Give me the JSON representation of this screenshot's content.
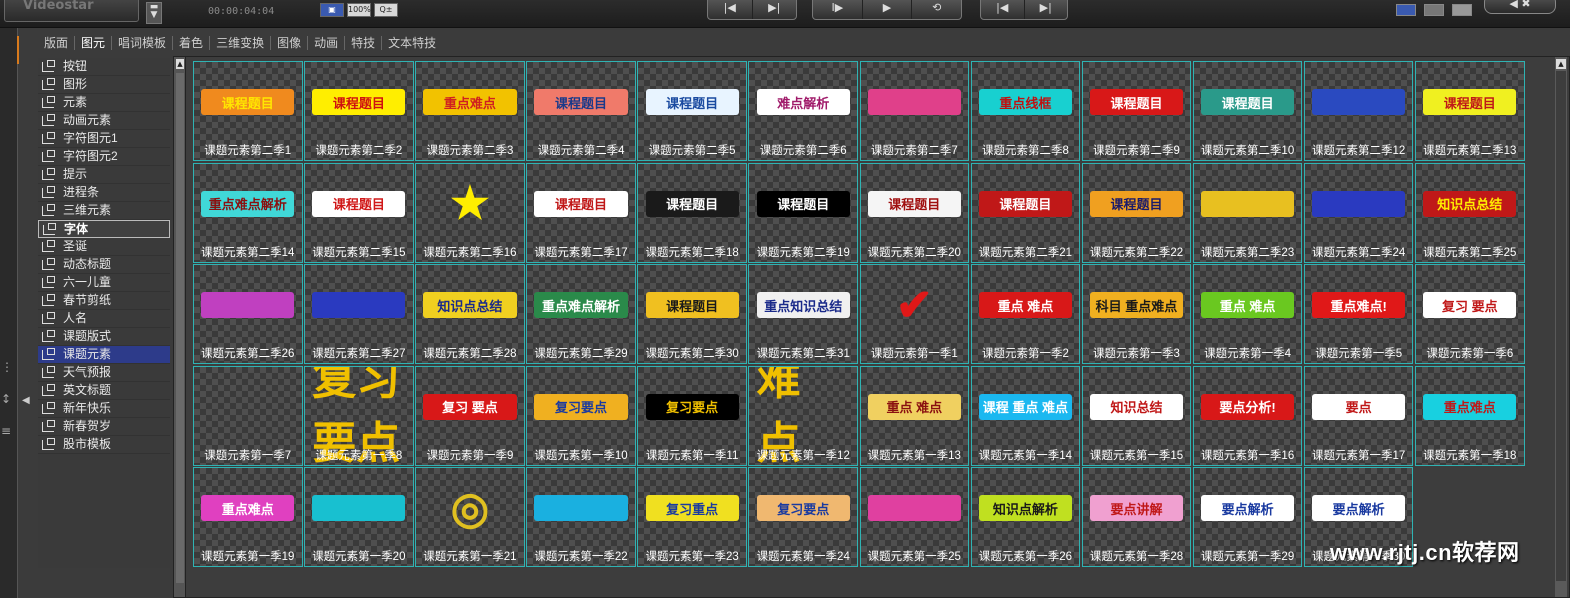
{
  "app": {
    "logo_text": "Videostar",
    "timecode": "00:00:04:04",
    "zoom_label": "100%",
    "tool_buttons": [
      "▣",
      "100%",
      "Q±"
    ],
    "transport": [
      "|◀",
      "▶|",
      "I▶",
      "▶",
      "⟲",
      "|◀",
      "▶|"
    ],
    "window_ctl": "◀ ✖",
    "watermark": "www.rjtj.cn软荐网"
  },
  "tabs": [
    {
      "label": "版面",
      "active": false
    },
    {
      "label": "图元",
      "active": true
    },
    {
      "label": "唱词模板",
      "active": false
    },
    {
      "label": "着色",
      "active": false
    },
    {
      "label": "三维变换",
      "active": false
    },
    {
      "label": "图像",
      "active": false
    },
    {
      "label": "动画",
      "active": false
    },
    {
      "label": "特技",
      "active": false
    },
    {
      "label": "文本特技",
      "active": false
    }
  ],
  "tree": [
    {
      "label": "按钮"
    },
    {
      "label": "图形"
    },
    {
      "label": "元素"
    },
    {
      "label": "动画元素"
    },
    {
      "label": "字符图元1"
    },
    {
      "label": "字符图元2"
    },
    {
      "label": "提示"
    },
    {
      "label": "进程条"
    },
    {
      "label": "三维元素"
    },
    {
      "label": "字体",
      "state": "boxed"
    },
    {
      "label": "圣诞"
    },
    {
      "label": "动态标题"
    },
    {
      "label": "六一儿童"
    },
    {
      "label": "春节剪纸"
    },
    {
      "label": "人名"
    },
    {
      "label": "课题版式"
    },
    {
      "label": "课题元素",
      "state": "selected"
    },
    {
      "label": "天气预报"
    },
    {
      "label": "英文标题"
    },
    {
      "label": "新年快乐"
    },
    {
      "label": "新春贺岁"
    },
    {
      "label": "股市模板"
    }
  ],
  "thumbs": [
    {
      "caption": "课题元素第二季1",
      "text": "课程题目",
      "bg": "#f08a1e",
      "fg": "#ffe600"
    },
    {
      "caption": "课题元素第二季2",
      "text": "课程题目",
      "bg": "#ffee00",
      "fg": "#d01010"
    },
    {
      "caption": "课题元素第二季3",
      "text": "重点难点",
      "bg": "#f2c200",
      "fg": "#d02020"
    },
    {
      "caption": "课题元素第二季4",
      "text": "课程题目",
      "bg": "#f07a6a",
      "fg": "#1a3a8a"
    },
    {
      "caption": "课题元素第二季5",
      "text": "课程题目",
      "bg": "#e8f4ff",
      "fg": "#1a4aa0"
    },
    {
      "caption": "课题元素第二季6",
      "text": "难点解析",
      "bg": "#ffffff",
      "fg": "#a01a6a"
    },
    {
      "caption": "课题元素第二季7",
      "text": "",
      "bg": "#e0408a",
      "fg": "#ffffff"
    },
    {
      "caption": "课题元素第二季8",
      "text": "重点线框",
      "bg": "#18d0d0",
      "fg": "#c01010"
    },
    {
      "caption": "课题元素第二季9",
      "text": "课程题目",
      "bg": "#d81818",
      "fg": "#ffffff"
    },
    {
      "caption": "课题元素第二季10",
      "text": "课程题目",
      "bg": "#2a9a8a",
      "fg": "#ffffff"
    },
    {
      "caption": "课题元素第二季12",
      "text": "",
      "bg": "#2a4ac0",
      "fg": "#ffffff"
    },
    {
      "caption": "课题元素第二季13",
      "text": "课程题目",
      "bg": "#f0f020",
      "fg": "#c01818"
    },
    {
      "caption": "课题元素第二季14",
      "text": "重点难点解析",
      "bg": "#40d8d8",
      "fg": "#8a1010"
    },
    {
      "caption": "课题元素第二季15",
      "text": "课程题目",
      "bg": "#ffffff",
      "fg": "#d01818"
    },
    {
      "caption": "课题元素第二季16",
      "text": "★",
      "bg": "transparent",
      "fg": "#ffee00"
    },
    {
      "caption": "课题元素第二季17",
      "text": "课程题目",
      "bg": "#ffffff",
      "fg": "#c01818"
    },
    {
      "caption": "课题元素第二季18",
      "text": "课程题目",
      "bg": "#1a1a1a",
      "fg": "#ffffff"
    },
    {
      "caption": "课题元素第二季19",
      "text": "课程题目",
      "bg": "#000000",
      "fg": "#ffffff"
    },
    {
      "caption": "课题元素第二季20",
      "text": "课程题目",
      "bg": "#f5f5f5",
      "fg": "#a01010"
    },
    {
      "caption": "课题元素第二季21",
      "text": "课程题目",
      "bg": "#c01818",
      "fg": "#ffffff"
    },
    {
      "caption": "课题元素第二季22",
      "text": "课程题目",
      "bg": "#f0a020",
      "fg": "#1a1a6a"
    },
    {
      "caption": "课题元素第二季23",
      "text": "",
      "bg": "#e8c020",
      "fg": "#ffffff"
    },
    {
      "caption": "课题元素第二季24",
      "text": "",
      "bg": "#2a3ac0",
      "fg": "#ffee00"
    },
    {
      "caption": "课题元素第二季25",
      "text": "知识点总结",
      "bg": "#c01818",
      "fg": "#ffee00"
    },
    {
      "caption": "课题元素第二季26",
      "text": "",
      "bg": "#c040c0",
      "fg": "#ffffff"
    },
    {
      "caption": "课题元素第二季27",
      "text": "",
      "bg": "#2a3ac0",
      "fg": "#ffee00"
    },
    {
      "caption": "课题元素第二季28",
      "text": "知识点总结",
      "bg": "#f0d020",
      "fg": "#1a2a8a"
    },
    {
      "caption": "课题元素第二季29",
      "text": "重点难点解析",
      "bg": "#2a8a4a",
      "fg": "#ffffff"
    },
    {
      "caption": "课题元素第二季30",
      "text": "课程题目",
      "bg": "#f0c020",
      "fg": "#1a1a1a"
    },
    {
      "caption": "课题元素第二季31",
      "text": "重点知识总结",
      "bg": "#f0f0f0",
      "fg": "#1a2a8a"
    },
    {
      "caption": "课题元素第一季1",
      "text": "✔",
      "bg": "transparent",
      "fg": "#e01818"
    },
    {
      "caption": "课题元素第一季2",
      "text": "重点 难点",
      "bg": "#d81818",
      "fg": "#ffffff"
    },
    {
      "caption": "课题元素第一季3",
      "text": "科目 重点难点",
      "bg": "#f0b020",
      "fg": "#1a1a1a"
    },
    {
      "caption": "课题元素第一季4",
      "text": "重点 难点",
      "bg": "#6ac820",
      "fg": "#ffffff"
    },
    {
      "caption": "课题元素第一季5",
      "text": "重点难点!",
      "bg": "#e01818",
      "fg": "#ffffff"
    },
    {
      "caption": "课题元素第一季6",
      "text": "复习 要点",
      "bg": "#ffffff",
      "fg": "#c01818"
    },
    {
      "caption": "课题元素第一季7",
      "text": "",
      "bg": "transparent",
      "fg": "#d01818"
    },
    {
      "caption": "课题元素第一季8",
      "text": "复习要点",
      "bg": "transparent",
      "fg": "#f0c000"
    },
    {
      "caption": "课题元素第一季9",
      "text": "复习 要点",
      "bg": "#d81818",
      "fg": "#ffffff"
    },
    {
      "caption": "课题元素第一季10",
      "text": "复习要点",
      "bg": "#f0b020",
      "fg": "#1a3aa0"
    },
    {
      "caption": "课题元素第一季11",
      "text": "复习要点",
      "bg": "#000000",
      "fg": "#f0c000"
    },
    {
      "caption": "课题元素第一季12",
      "text": "难 点",
      "bg": "transparent",
      "fg": "#f0c000"
    },
    {
      "caption": "课题元素第一季13",
      "text": "重点 难点",
      "bg": "#f0d060",
      "fg": "#8a1010"
    },
    {
      "caption": "课题元素第一季14",
      "text": "课程 重点 难点",
      "bg": "#1ab8f0",
      "fg": "#ffffff"
    },
    {
      "caption": "课题元素第一季15",
      "text": "知识总结",
      "bg": "#ffffff",
      "fg": "#c01818"
    },
    {
      "caption": "课题元素第一季16",
      "text": "要点分析!",
      "bg": "#d81818",
      "fg": "#ffffff"
    },
    {
      "caption": "课题元素第一季17",
      "text": "要点",
      "bg": "#ffffff",
      "fg": "#c01818"
    },
    {
      "caption": "课题元素第一季18",
      "text": "重点难点",
      "bg": "#18d0e0",
      "fg": "#c01818"
    },
    {
      "caption": "课题元素第一季19",
      "text": "重点难点",
      "bg": "#e040c0",
      "fg": "#ffffff"
    },
    {
      "caption": "课题元素第一季20",
      "text": "",
      "bg": "#18c0d0",
      "fg": "#1a1a6a"
    },
    {
      "caption": "课题元素第一季21",
      "text": "◎",
      "bg": "transparent",
      "fg": "#e0c020"
    },
    {
      "caption": "课题元素第一季22",
      "text": "",
      "bg": "#1ab0e0",
      "fg": "#ffffff"
    },
    {
      "caption": "课题元素第一季23",
      "text": "复习重点",
      "bg": "#f0e020",
      "fg": "#1a3aa0"
    },
    {
      "caption": "课题元素第一季24",
      "text": "复习要点",
      "bg": "#f0b870",
      "fg": "#1a3aa0"
    },
    {
      "caption": "课题元素第一季25",
      "text": "",
      "bg": "#e040a0",
      "fg": "#ffffff"
    },
    {
      "caption": "课题元素第一季26",
      "text": "知识点解析",
      "bg": "#c0e020",
      "fg": "#1a1a1a"
    },
    {
      "caption": "课题元素第一季28",
      "text": "要点讲解",
      "bg": "#f0a0d0",
      "fg": "#c01818"
    },
    {
      "caption": "课题元素第一季29",
      "text": "要点解析",
      "bg": "#ffffff",
      "fg": "#1a3aa0"
    },
    {
      "caption": "课题元素第一季30",
      "text": "要点解析",
      "bg": "#ffffff",
      "fg": "#1a3aa0"
    }
  ],
  "colors": {
    "accent_selected": "#2d3b8a",
    "thumb_border": "#2fb3b3"
  }
}
